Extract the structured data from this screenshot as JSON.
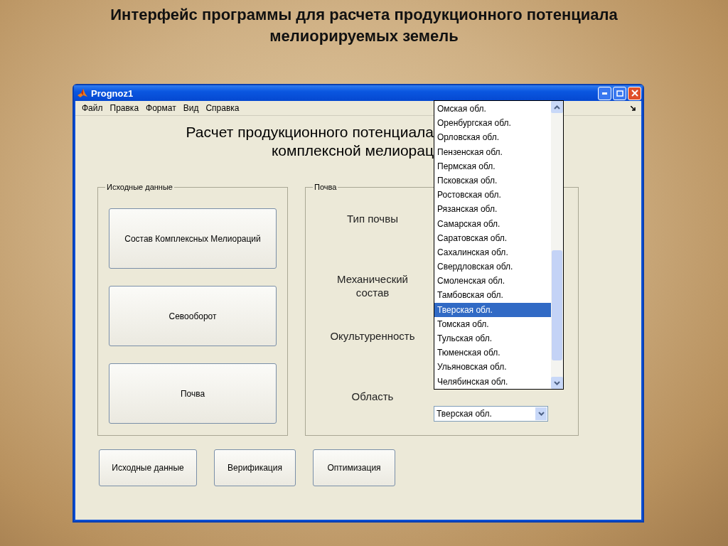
{
  "slide_title_lines": [
    "Интерфейс программы для расчета продукционного потенциала",
    "мелиорируемых земель"
  ],
  "window": {
    "title": "Prognoz1"
  },
  "menu": [
    "Файл",
    "Правка",
    "Формат",
    "Вид",
    "Справка"
  ],
  "heading_lines": [
    "Расчет продукционного потенциала",
    "комплексной мелиорац"
  ],
  "source_group": {
    "label": "Исходные данные",
    "buttons": [
      "Состав Комплексных Мелиораций",
      "Севооборот",
      "Почва"
    ]
  },
  "soil_group": {
    "label": "Почва",
    "labels": [
      "Тип почвы",
      "Механический состав",
      "Окультуренность",
      "Область"
    ]
  },
  "region_dropdown": {
    "value": "Тверская обл.",
    "expanded": true,
    "options": [
      {
        "label": "Омская обл.",
        "selected": false
      },
      {
        "label": "Оренбургская обл.",
        "selected": false
      },
      {
        "label": "Орловская обл.",
        "selected": false
      },
      {
        "label": "Пензенская обл.",
        "selected": false
      },
      {
        "label": "Пермская обл.",
        "selected": false
      },
      {
        "label": "Псковская обл.",
        "selected": false
      },
      {
        "label": "Ростовская обл.",
        "selected": false
      },
      {
        "label": "Рязанская обл.",
        "selected": false
      },
      {
        "label": "Самарская обл.",
        "selected": false
      },
      {
        "label": "Саратовская обл.",
        "selected": false
      },
      {
        "label": "Сахалинская обл.",
        "selected": false
      },
      {
        "label": "Свердловская обл.",
        "selected": false
      },
      {
        "label": "Смоленская обл.",
        "selected": false
      },
      {
        "label": "Тамбовская обл.",
        "selected": false
      },
      {
        "label": "Тверская обл.",
        "selected": true
      },
      {
        "label": "Томская обл.",
        "selected": false
      },
      {
        "label": "Тульская обл.",
        "selected": false
      },
      {
        "label": "Тюменская обл.",
        "selected": false
      },
      {
        "label": "Ульяновская обл.",
        "selected": false
      },
      {
        "label": "Челябинская обл.",
        "selected": false
      }
    ]
  },
  "bottom_buttons": [
    "Исходные данные",
    "Верификация",
    "Оптимизация"
  ]
}
